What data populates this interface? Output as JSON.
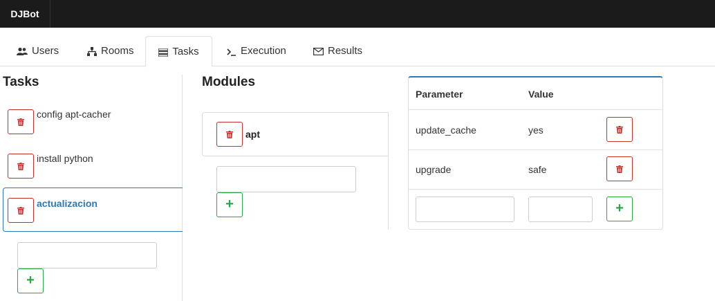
{
  "navbar": {
    "brand": "DJBot"
  },
  "tabs": [
    {
      "label": "Users",
      "icon": "users-icon"
    },
    {
      "label": "Rooms",
      "icon": "sitemap-icon"
    },
    {
      "label": "Tasks",
      "icon": "tasks-icon",
      "active": true
    },
    {
      "label": "Execution",
      "icon": "terminal-icon"
    },
    {
      "label": "Results",
      "icon": "envelope-icon"
    }
  ],
  "tasks": {
    "heading": "Tasks",
    "items": [
      {
        "label": "config apt-cacher"
      },
      {
        "label": "install python"
      },
      {
        "label": "actualizacion",
        "active": true
      }
    ],
    "new_task_value": ""
  },
  "modules": {
    "heading": "Modules",
    "items": [
      {
        "label": "apt"
      }
    ],
    "new_module_value": ""
  },
  "parameters": {
    "headers": {
      "parameter": "Parameter",
      "value": "Value"
    },
    "rows": [
      {
        "parameter": "update_cache",
        "value": "yes"
      },
      {
        "parameter": "upgrade",
        "value": "safe"
      }
    ],
    "new_parameter_value": "",
    "new_value_value": ""
  },
  "colors": {
    "accent": "#2a7ab8",
    "danger": "#c9302c",
    "success": "#28a745",
    "navbar": "#1b1b1b"
  }
}
